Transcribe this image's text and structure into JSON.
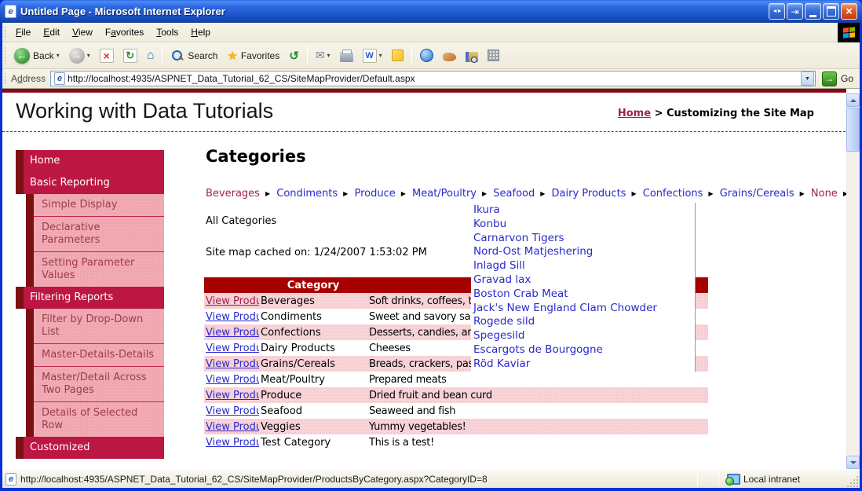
{
  "window": {
    "title": "Untitled Page - Microsoft Internet Explorer",
    "menu": [
      {
        "label": "File",
        "accel": 0
      },
      {
        "label": "Edit",
        "accel": 0
      },
      {
        "label": "View",
        "accel": 0
      },
      {
        "label": "Favorites",
        "accel": 1
      },
      {
        "label": "Tools",
        "accel": 0
      },
      {
        "label": "Help",
        "accel": 0
      }
    ],
    "toolbar": {
      "back_label": "Back",
      "search_label": "Search",
      "favorites_label": "Favorites"
    },
    "address": {
      "label": "Address",
      "accel": 1,
      "value": "http://localhost:4935/ASPNET_Data_Tutorial_62_CS/SiteMapProvider/Default.aspx",
      "go_label": "Go"
    }
  },
  "icons": {
    "back": "green-circle-left-arrow",
    "forward": "gray-circle-right-arrow",
    "stop": "red-x",
    "refresh": "green-circular-arrows",
    "home": "house",
    "search": "magnifier",
    "favorites": "yellow-star",
    "history": "green-counterclockwise-arrow",
    "mail": "envelope",
    "print": "printer",
    "edit-word": "word-w",
    "notes": "yellow-note",
    "go": "green-right-arrow",
    "menu-arrow": "black-right-triangle",
    "zone": "monitor-globe",
    "windows-logo": "four-color-flag"
  },
  "page": {
    "title": "Working with Data Tutorials",
    "breadcrumb": {
      "home": "Home",
      "separator": ">",
      "current": "Customizing the Site Map"
    },
    "sidebar": [
      {
        "label": "Home",
        "type": "top"
      },
      {
        "label": "Basic Reporting",
        "type": "top"
      },
      {
        "label": "Simple Display",
        "type": "sub"
      },
      {
        "label": "Declarative Parameters",
        "type": "sub"
      },
      {
        "label": "Setting Parameter Values",
        "type": "sub"
      },
      {
        "label": "Filtering Reports",
        "type": "top"
      },
      {
        "label": "Filter by Drop-Down List",
        "type": "sub"
      },
      {
        "label": "Master-Details-Details",
        "type": "sub"
      },
      {
        "label": "Master/Detail Across Two Pages",
        "type": "sub"
      },
      {
        "label": "Details of Selected Row",
        "type": "sub"
      },
      {
        "label": "Customized",
        "type": "top"
      }
    ],
    "content": {
      "heading": "Categories",
      "menu_arrow": "▶",
      "menu": [
        {
          "label": "Beverages",
          "tone": "red"
        },
        {
          "label": "Condiments",
          "tone": "blue"
        },
        {
          "label": "Produce",
          "tone": "blue"
        },
        {
          "label": "Meat/Poultry",
          "tone": "blue"
        },
        {
          "label": "Seafood",
          "tone": "blue"
        },
        {
          "label": "Dairy Products",
          "tone": "blue"
        },
        {
          "label": "Confections",
          "tone": "blue"
        },
        {
          "label": "Grains/Cereals",
          "tone": "blue"
        },
        {
          "label": "None",
          "tone": "red"
        }
      ],
      "all_categories_label": "All Categories",
      "cache_note": "Site map cached on: 1/24/2007 1:53:02 PM",
      "table": {
        "headers": [
          "",
          "Category",
          ""
        ],
        "rows": [
          {
            "link": "View Products",
            "category": "Beverages",
            "desc": "Soft drinks, coffees, teas, beers, and ales",
            "tone": "visited"
          },
          {
            "link": "View Products",
            "category": "Condiments",
            "desc": "Sweet and savory sauces, relishes, spreads, and seasonings"
          },
          {
            "link": "View Products",
            "category": "Confections",
            "desc": "Desserts, candies, and sweet breads"
          },
          {
            "link": "View Products",
            "category": "Dairy Products",
            "desc": "Cheeses"
          },
          {
            "link": "View Products",
            "category": "Grains/Cereals",
            "desc": "Breads, crackers, pasta, and cereal"
          },
          {
            "link": "View Products",
            "category": "Meat/Poultry",
            "desc": "Prepared meats"
          },
          {
            "link": "View Products",
            "category": "Produce",
            "desc": "Dried fruit and bean curd"
          },
          {
            "link": "View Products",
            "category": "Seafood",
            "desc": "Seaweed and fish"
          },
          {
            "link": "View Products",
            "category": "Veggies",
            "desc": "Yummy vegetables!"
          },
          {
            "link": "View Products",
            "category": "Test Category",
            "desc": "This is a test!"
          }
        ]
      },
      "flyout": [
        "Ikura",
        "Konbu",
        "Carnarvon Tigers",
        "Nord-Ost Matjeshering",
        "Inlagd Sill",
        "Gravad lax",
        "Boston Crab Meat",
        "Jack's New England Clam Chowder",
        "Rogede sild",
        "Spegesild",
        "Escargots de Bourgogne",
        "Röd Kaviar"
      ]
    }
  },
  "statusbar": {
    "url": "http://localhost:4935/ASPNET_Data_Tutorial_62_CS/SiteMapProvider/ProductsByCategory.aspx?CategoryID=8",
    "zone": "Local intranet"
  },
  "colors": {
    "xpblue": "#0831D9",
    "maroon": "#7B1113",
    "crimson": "#BC1743",
    "table_header_red": "#A60000",
    "pink_row": "#F8D4D8",
    "sub_item_pink": "#F0A6B0",
    "link_blue": "#2929CC",
    "link_red": "#9E2647"
  }
}
